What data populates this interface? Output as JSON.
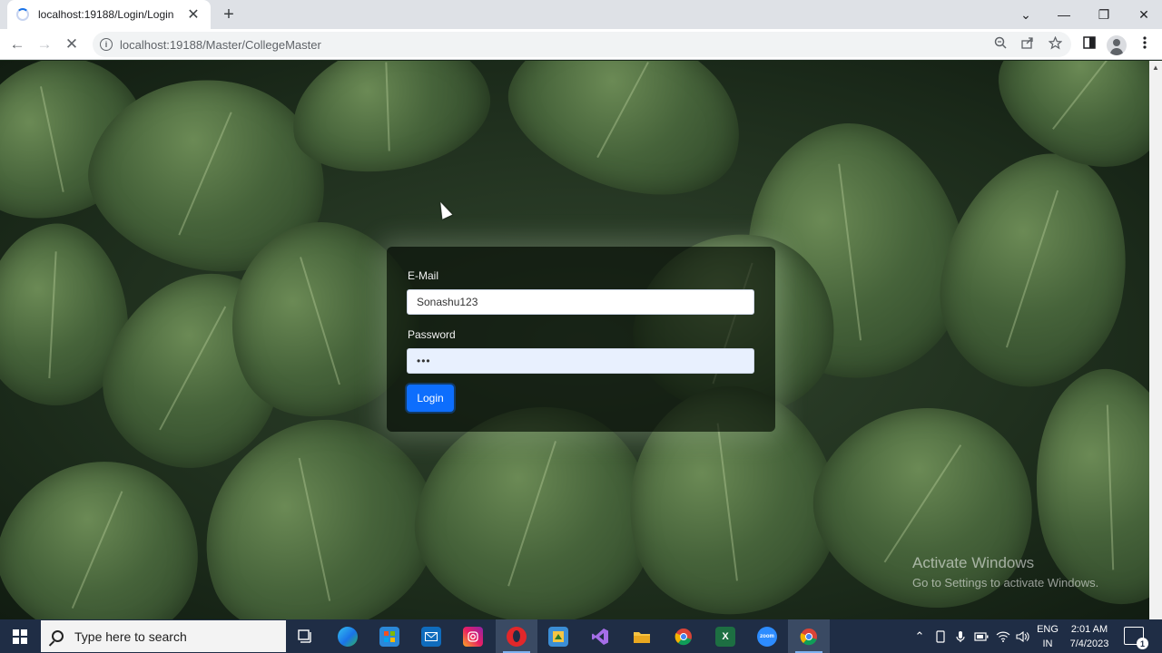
{
  "browser": {
    "tab_title": "localhost:19188/Login/Login",
    "tab_close": "✕",
    "new_tab": "+",
    "url": "localhost:19188/Master/CollegeMaster",
    "window_controls": {
      "dropdown": "⌄",
      "minimize": "—",
      "restore": "❐",
      "close": "✕"
    },
    "nav": {
      "back": "←",
      "forward": "→",
      "stop": "✕"
    }
  },
  "login_form": {
    "email_label": "E-Mail",
    "email_value": "Sonashu123",
    "password_label": "Password",
    "password_value": "•••",
    "login_button": "Login",
    "button_color": "#0d6efd"
  },
  "watermark": {
    "title": "Activate Windows",
    "subtitle": "Go to Settings to activate Windows."
  },
  "taskbar": {
    "search_placeholder": "Type here to search",
    "language_line1": "ENG",
    "language_line2": "IN",
    "time": "2:01 AM",
    "date": "7/4/2023",
    "notification_count": "1",
    "apps": [
      "task-view",
      "edge",
      "store",
      "mail",
      "instagram",
      "opera",
      "app",
      "visual-studio",
      "file-explorer",
      "chrome",
      "excel",
      "zoom",
      "chrome-active"
    ]
  }
}
